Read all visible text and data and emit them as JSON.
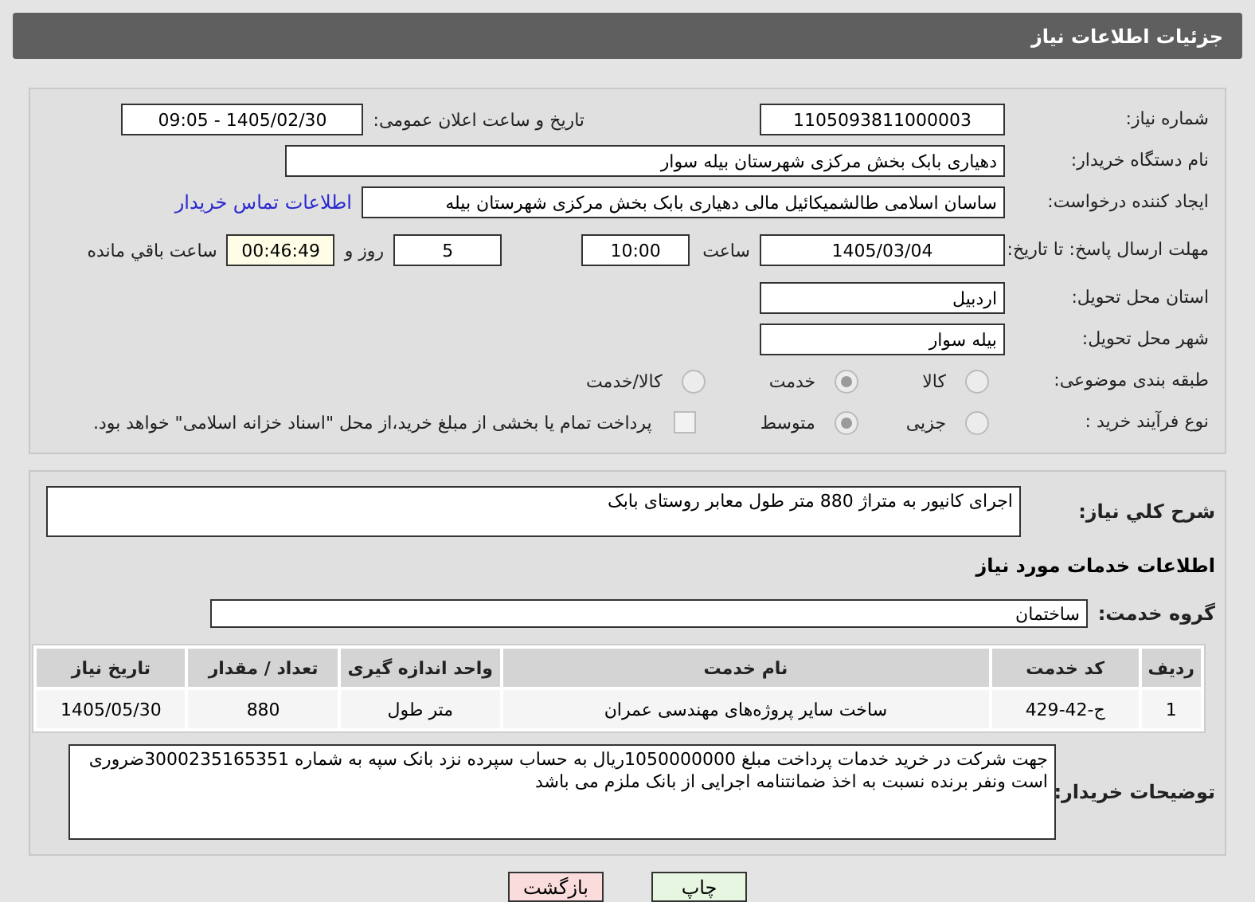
{
  "header": {
    "title": "جزئیات اطلاعات نیاز"
  },
  "details": {
    "need_number": {
      "label": "شماره نیاز:",
      "value": "1105093811000003"
    },
    "announce": {
      "label": "تاریخ و ساعت اعلان عمومی:",
      "value": "1405/02/30 - 09:05"
    },
    "buyer": {
      "label": "نام دستگاه خریدار:",
      "value": "دهیاری بابک بخش مرکزی شهرستان بیله سوار"
    },
    "creator": {
      "label": "ایجاد کننده درخواست:",
      "value": "ساسان اسلامی طالشمیکائیل مالی دهیاری بابک بخش مرکزی شهرستان بیله",
      "link": "اطلاعات تماس خریدار"
    },
    "deadline": {
      "label": "مهلت ارسال پاسخ: تا تاریخ:",
      "date": "1405/03/04",
      "time_label": "ساعت",
      "time": "10:00",
      "days": "5",
      "days_label": "روز و",
      "remaining": "00:46:49",
      "remaining_label": "ساعت باقي مانده"
    },
    "province": {
      "label": "استان محل تحویل:",
      "value": "اردبیل"
    },
    "city": {
      "label": "شهر محل تحویل:",
      "value": "بیله سوار"
    },
    "category": {
      "label": "طبقه بندی موضوعی:",
      "options": [
        {
          "label": "کالا",
          "selected": false
        },
        {
          "label": "خدمت",
          "selected": true
        },
        {
          "label": "کالا/خدمت",
          "selected": false
        }
      ]
    },
    "process": {
      "label": "نوع فرآیند خرید :",
      "options": [
        {
          "label": "جزیی",
          "selected": false
        },
        {
          "label": "متوسط",
          "selected": true
        }
      ],
      "payment": {
        "checked": false,
        "text": "پرداخت تمام یا بخشی از مبلغ خرید،از محل \"اسناد خزانه اسلامی\" خواهد بود."
      }
    }
  },
  "services": {
    "description": {
      "label": "شرح کلي نیاز:",
      "value": "اجرای کانیور به متراژ 880 متر طول  معابر روستای بابک"
    },
    "heading": "اطلاعات خدمات مورد نیاز",
    "group": {
      "label": "گروه خدمت:",
      "value": "ساختمان"
    },
    "table": {
      "columns": [
        "ردیف",
        "کد خدمت",
        "نام خدمت",
        "واحد اندازه گیری",
        "تعداد / مقدار",
        "تاریخ نیاز"
      ],
      "rows": [
        [
          "1",
          "ج-42-429",
          "ساخت سایر پروژه‌های مهندسی عمران",
          "متر طول",
          "880",
          "1405/05/30"
        ]
      ]
    },
    "notes": {
      "label": "توضیحات خریدار:",
      "value": "جهت  شرکت در خرید خدمات پرداخت مبلغ 1050000000ریال به حساب سپرده نزد بانک سپه به شماره 3000235165351ضروری است ونفر برنده نسبت به اخذ ضمانتنامه اجرایی از بانک ملزم می باشد"
    }
  },
  "buttons": [
    {
      "label": "چاپ",
      "kind": "print"
    },
    {
      "label": "بازگشت",
      "kind": "back"
    }
  ]
}
